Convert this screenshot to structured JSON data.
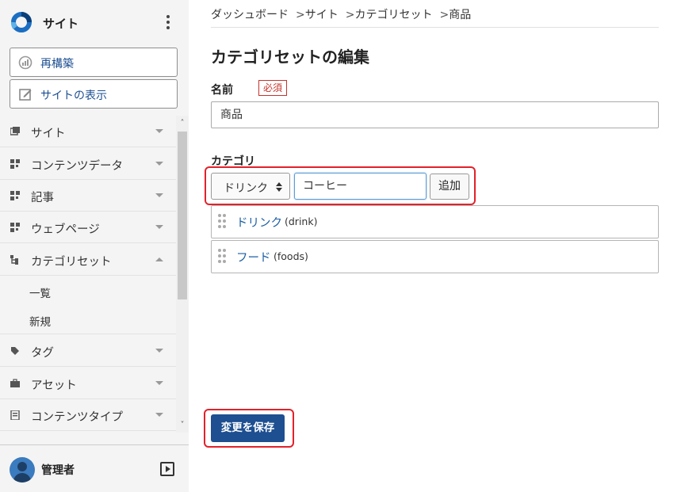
{
  "brand": {
    "name": "サイト",
    "logo_icon": "ring-logo-icon"
  },
  "sidebar": {
    "actions": [
      {
        "label": "再構築",
        "icon": "rebuild-gauge-icon"
      },
      {
        "label": "サイトの表示",
        "icon": "edit-square-icon"
      }
    ],
    "items": [
      {
        "label": "サイト",
        "icon": "windows-icon"
      },
      {
        "label": "コンテンツデータ",
        "icon": "grid-icon"
      },
      {
        "label": "記事",
        "icon": "grid-icon"
      },
      {
        "label": "ウェブページ",
        "icon": "grid-icon"
      },
      {
        "label": "カテゴリセット",
        "icon": "tree-icon",
        "expanded": true
      },
      {
        "label": "一覧"
      },
      {
        "label": "新規"
      },
      {
        "label": "タグ",
        "icon": "tag-icon"
      },
      {
        "label": "アセット",
        "icon": "briefcase-icon"
      },
      {
        "label": "コンテンツタイプ",
        "icon": "document-icon"
      }
    ],
    "user": {
      "name": "管理者"
    }
  },
  "breadcrumb": [
    "ダッシュボード",
    "サイト",
    "カテゴリセット",
    "商品"
  ],
  "page": {
    "title": "カテゴリセットの編集",
    "name_label": "名前",
    "required_badge": "必須",
    "name_value": "商品",
    "category_label": "カテゴリ",
    "category_select_value": "ドリンク",
    "category_input_value": "コーヒー",
    "add_button": "追加",
    "categories": [
      {
        "name": "ドリンク",
        "slug": "(drink)"
      },
      {
        "name": "フード",
        "slug": "(foods)"
      }
    ],
    "save_button": "変更を保存"
  },
  "colors": {
    "accent": "#1d4f91",
    "link": "#1d5fa5",
    "highlight": "#e3212a",
    "required": "#c4342c"
  }
}
